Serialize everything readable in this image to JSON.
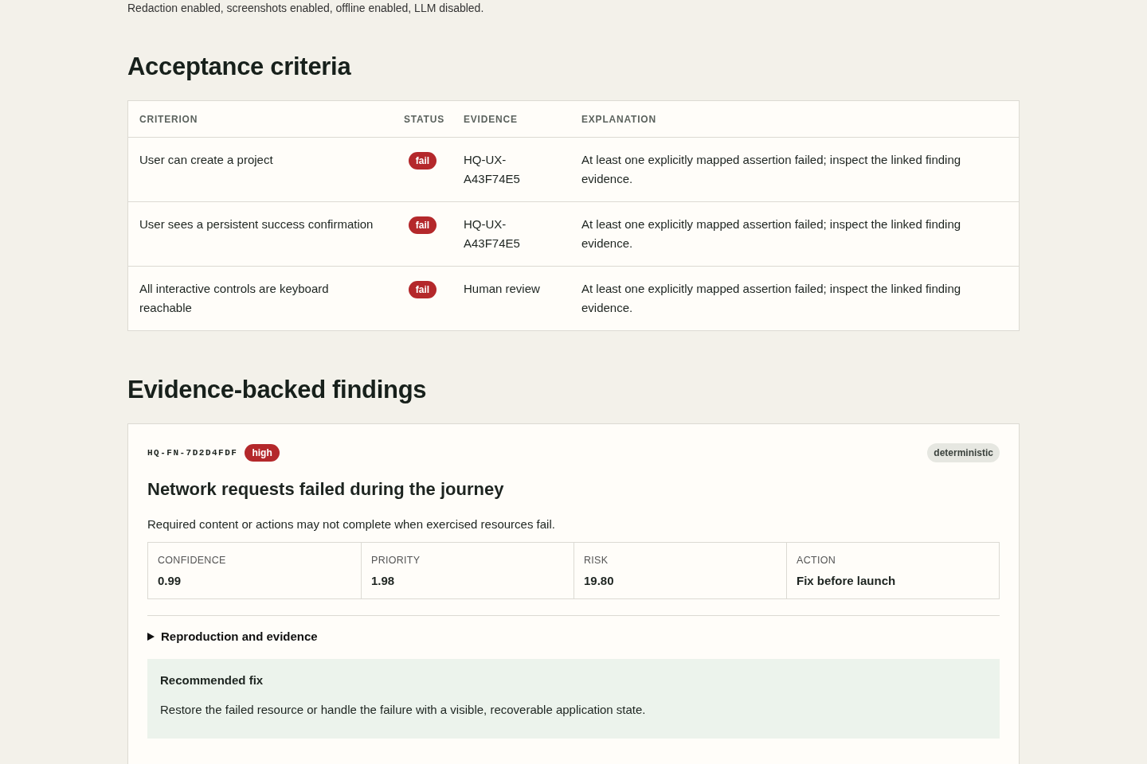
{
  "settings_line": "Redaction enabled, screenshots enabled, offline enabled, LLM disabled.",
  "acceptance": {
    "heading": "Acceptance criteria",
    "columns": [
      "CRITERION",
      "STATUS",
      "EVIDENCE",
      "EXPLANATION"
    ],
    "rows": [
      {
        "criterion": "User can create a project",
        "status": "fail",
        "evidence": "HQ-UX-A43F74E5",
        "explanation": "At least one explicitly mapped assertion failed; inspect the linked finding evidence."
      },
      {
        "criterion": "User sees a persistent success confirmation",
        "status": "fail",
        "evidence": "HQ-UX-A43F74E5",
        "explanation": "At least one explicitly mapped assertion failed; inspect the linked finding evidence."
      },
      {
        "criterion": "All interactive controls are keyboard reachable",
        "status": "fail",
        "evidence": "Human review",
        "explanation": "At least one explicitly mapped assertion failed; inspect the linked finding evidence."
      }
    ]
  },
  "findings": {
    "heading": "Evidence-backed findings",
    "items": [
      {
        "id": "HQ-FN-7D2D4FDF",
        "severity": "high",
        "source": "deterministic",
        "title": "Network requests failed during the journey",
        "summary": "Required content or actions may not complete when exercised resources fail.",
        "metrics": [
          {
            "label": "CONFIDENCE",
            "value": "0.99"
          },
          {
            "label": "PRIORITY",
            "value": "1.98"
          },
          {
            "label": "RISK",
            "value": "19.80"
          },
          {
            "label": "ACTION",
            "value": "Fix before launch"
          }
        ],
        "details": {
          "label": "Reproduction and evidence",
          "expanded": false
        },
        "fix": {
          "heading": "Recommended fix",
          "text": "Restore the failed resource or handle the failure with a visible, recoverable application state."
        }
      }
    ]
  }
}
